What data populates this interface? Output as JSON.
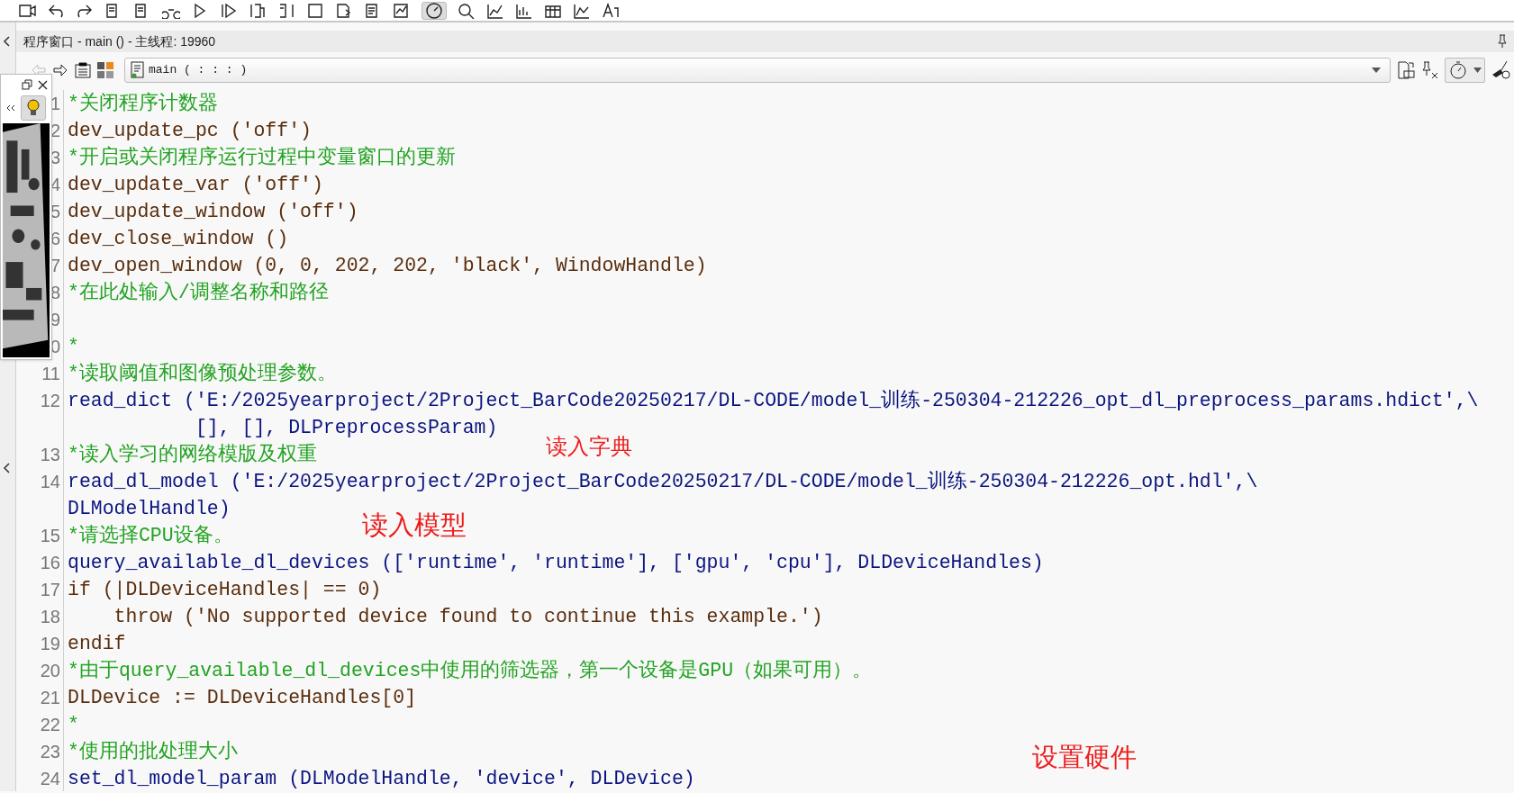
{
  "program_window": {
    "title": "程序窗口 - main () - 主线程: 19960",
    "procedure": "main ( : : : )"
  },
  "code_lines": [
    {
      "number": "1",
      "kind": "comment",
      "text": "*关闭程序计数器"
    },
    {
      "number": "2",
      "kind": "control",
      "text": "dev_update_pc ('off')"
    },
    {
      "number": "3",
      "kind": "comment",
      "text": "*开启或关闭程序运行过程中变量窗口的更新"
    },
    {
      "number": "4",
      "kind": "control",
      "text": "dev_update_var ('off')"
    },
    {
      "number": "5",
      "kind": "control",
      "text": "dev_update_window ('off')"
    },
    {
      "number": "6",
      "kind": "control",
      "text": "dev_close_window ()"
    },
    {
      "number": "7",
      "kind": "control",
      "text": "dev_open_window (0, 0, 202, 202, 'black', WindowHandle)"
    },
    {
      "number": "8",
      "kind": "comment",
      "text": "*在此处输入/调整名称和路径"
    },
    {
      "number": "9",
      "kind": "blank"
    },
    {
      "number": "0",
      "kind": "comment",
      "text": "*"
    },
    {
      "number": "11",
      "kind": "comment",
      "text": "*读取阈值和图像预处理参数。"
    },
    {
      "number": "12",
      "kind": "operator",
      "text": "read_dict ('E:/2025yearproject/2Project_BarCode20250217/DL-CODE/model_训练-250304-212226_opt_dl_preprocess_params.hdict',\\",
      "continuation": "           [], [], DLPreprocessParam)"
    },
    {
      "number": "13",
      "kind": "comment",
      "text": "*读入学习的网络模版及权重"
    },
    {
      "number": "14",
      "kind": "operator",
      "text": "read_dl_model ('E:/2025yearproject/2Project_BarCode20250217/DL-CODE/model_训练-250304-212226_opt.hdl',\\",
      "continuation": "DLModelHandle)"
    },
    {
      "number": "15",
      "kind": "comment",
      "text": "*请选择CPU设备。"
    },
    {
      "number": "16",
      "kind": "operator",
      "text": "query_available_dl_devices (['runtime', 'runtime'], ['gpu', 'cpu'], DLDeviceHandles)"
    },
    {
      "number": "17",
      "kind": "control",
      "text": "if (|DLDeviceHandles| == 0)"
    },
    {
      "number": "18",
      "kind": "control",
      "text": "    throw ('No supported device found to continue this example.')"
    },
    {
      "number": "19",
      "kind": "control",
      "text": "endif"
    },
    {
      "number": "20",
      "kind": "comment",
      "text": "*由于query_available_dl_devices中使用的筛选器，第一个设备是GPU（如果可用）。"
    },
    {
      "number": "21",
      "kind": "control",
      "text": "DLDevice := DLDeviceHandles[0]"
    },
    {
      "number": "22",
      "kind": "comment",
      "text": "*"
    },
    {
      "number": "23",
      "kind": "comment",
      "text": "*使用的批处理大小"
    },
    {
      "number": "24",
      "kind": "operator",
      "text": "set_dl_model_param (DLModelHandle, 'device', DLDevice)"
    }
  ],
  "annotations": [
    {
      "text": "读入字典"
    },
    {
      "text": "读入模型"
    },
    {
      "text": "设置硬件"
    }
  ]
}
